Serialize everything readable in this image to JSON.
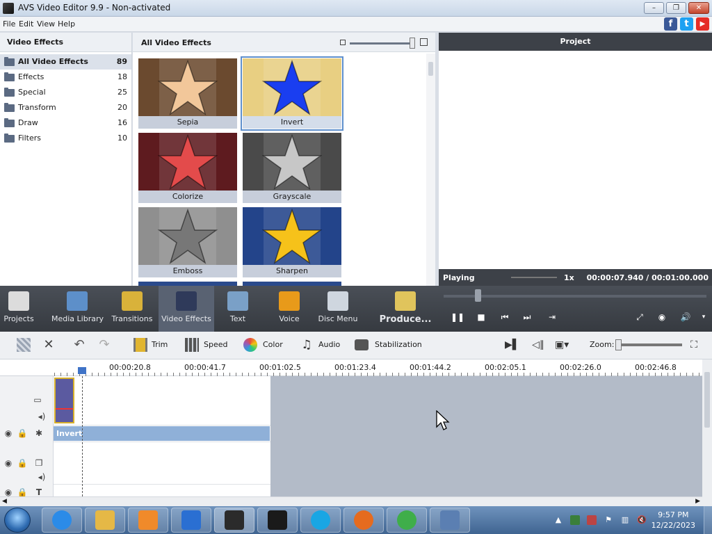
{
  "window": {
    "title": "AVS Video Editor 9.9 - Non-activated",
    "min": "–",
    "max": "❐",
    "close": "✕"
  },
  "menu": [
    "File",
    "Edit",
    "View",
    "Help"
  ],
  "social": [
    {
      "name": "facebook",
      "glyph": "f",
      "color": "#3b5998"
    },
    {
      "name": "twitter",
      "glyph": "t",
      "color": "#1da1f2"
    },
    {
      "name": "youtube",
      "glyph": "▶",
      "color": "#e52d27"
    }
  ],
  "categories": {
    "header": "Video Effects",
    "items": [
      {
        "label": "All Video Effects",
        "count": "89",
        "selected": true
      },
      {
        "label": "Effects",
        "count": "18"
      },
      {
        "label": "Special",
        "count": "25"
      },
      {
        "label": "Transform",
        "count": "20"
      },
      {
        "label": "Draw",
        "count": "16"
      },
      {
        "label": "Filters",
        "count": "10"
      }
    ]
  },
  "effects": {
    "header": "All Video Effects",
    "tiles": [
      {
        "name": "Sepia",
        "bg": "#6b4a2f",
        "star": "#f2c79a"
      },
      {
        "name": "Invert",
        "bg": "#e8cf82",
        "star": "#1a3ef0",
        "selected": true
      },
      {
        "name": "Colorize",
        "bg": "#5e1b1f",
        "star": "#e34b4b"
      },
      {
        "name": "Grayscale",
        "bg": "#4a4a4a",
        "star": "#c7c7c7"
      },
      {
        "name": "Emboss",
        "bg": "#8f8f8f",
        "star": "#777777"
      },
      {
        "name": "Sharpen",
        "bg": "#23448a",
        "star": "#f6c21a"
      }
    ]
  },
  "preview": {
    "title": "Project",
    "status": "Playing",
    "speed": "1x",
    "time": "00:00:07.940 / 00:01:00.000"
  },
  "toolbar": [
    {
      "label": "Projects",
      "color": "#dcdcdc"
    },
    {
      "label": "Media Library",
      "color": "#5d8fc9"
    },
    {
      "label": "Transitions",
      "color": "#d9b23a"
    },
    {
      "label": "Video Effects",
      "color": "#2f3a5a",
      "active": true
    },
    {
      "label": "Text",
      "color": "#7aa0c7"
    },
    {
      "label": "Voice",
      "color": "#e89a1a"
    },
    {
      "label": "Disc Menu",
      "color": "#cfd6df"
    },
    {
      "label": "Produce...",
      "color": "#e0c45c"
    }
  ],
  "player": {
    "pause": "❚❚",
    "stop": "■",
    "prev": "⏮",
    "next": "⏭",
    "mode": "⇥",
    "fullscreen": "⤢",
    "snapshot": "◉",
    "volume": "🔊"
  },
  "timeline_tools": {
    "trim": "Trim",
    "speed": "Speed",
    "color": "Color",
    "audio": "Audio",
    "stabilization": "Stabilization",
    "zoom": "Zoom:"
  },
  "ruler": [
    "00:00:20.8",
    "00:00:41.7",
    "00:01:02.5",
    "00:01:23.4",
    "00:01:44.2",
    "00:02:05.1",
    "00:02:26.0",
    "00:02:46.8"
  ],
  "timeline": {
    "effect_strip": "Invert"
  },
  "taskbar": {
    "apps": [
      {
        "name": "internet-explorer",
        "color": "#2b8be8"
      },
      {
        "name": "file-explorer",
        "color": "#e5b846"
      },
      {
        "name": "media-player",
        "color": "#f08a2a"
      },
      {
        "name": "avs-editor-lightning",
        "color": "#2a6fd2"
      },
      {
        "name": "avs-video-editor",
        "color": "#2b2b2b",
        "active": true
      },
      {
        "name": "video-tool",
        "color": "#1a1a1a"
      },
      {
        "name": "skype",
        "color": "#19a6e4"
      },
      {
        "name": "firefox",
        "color": "#e56b1f"
      },
      {
        "name": "chrome",
        "color": "#3fae4a"
      },
      {
        "name": "remote-desktop",
        "color": "#5b7fb2"
      }
    ],
    "time": "9:57 PM",
    "date": "12/22/2023"
  }
}
